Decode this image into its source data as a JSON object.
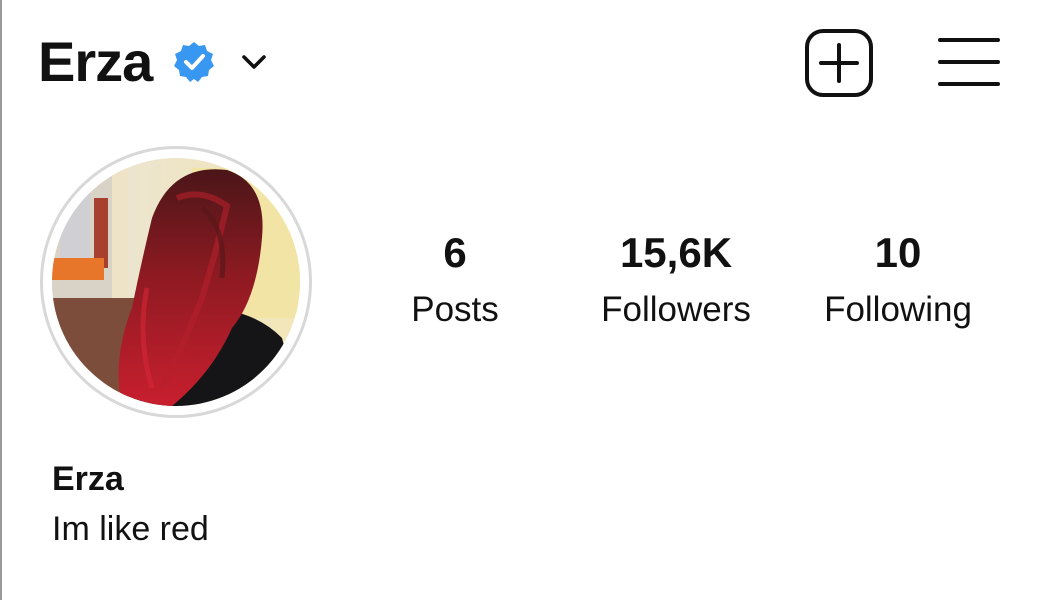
{
  "header": {
    "username": "Erza",
    "verified_icon": "verified-badge-icon",
    "dropdown_icon": "chevron-down-icon",
    "add_icon": "add-post-icon",
    "menu_icon": "hamburger-menu-icon"
  },
  "profile": {
    "avatar_icon": "profile-avatar",
    "display_name": "Erza",
    "bio": "Im like red"
  },
  "stats": {
    "posts": {
      "value": "6",
      "label": "Posts"
    },
    "followers": {
      "value": "15,6K",
      "label": "Followers"
    },
    "following": {
      "value": "10",
      "label": "Following"
    }
  },
  "colors": {
    "verified": "#3897f0",
    "text": "#111111",
    "ring": "#d8d8d8"
  }
}
